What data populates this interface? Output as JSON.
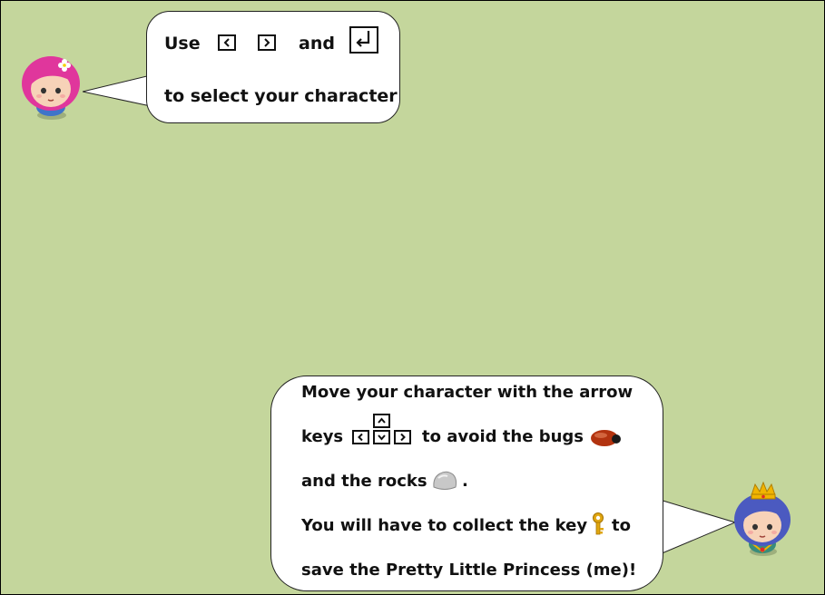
{
  "colors": {
    "background": "#c4d69c",
    "bubble_fill": "#ffffff",
    "bubble_border": "#222222",
    "girl_hair": "#e0369c",
    "princess_hair": "#4b5ac0",
    "crown": "#f1b400",
    "bug": "#b2330f",
    "rock": "#c8c8c8",
    "key_icon": "#e0a610"
  },
  "intro_bubble": {
    "use": "Use",
    "and": "and",
    "select": "to select your character",
    "icons": [
      "left-arrow-key",
      "right-arrow-key",
      "enter-key"
    ]
  },
  "instructions_bubble": {
    "line1": "Move your character with the arrow",
    "keys_word": "keys",
    "avoid_bugs": "to avoid the bugs",
    "rocks": "and the rocks",
    "period": ".",
    "collect": "You will have to collect the key",
    "to": "to",
    "save": "save the Pretty Little Princess (me)!",
    "icons": [
      "up-arrow-key",
      "left-arrow-key",
      "down-arrow-key",
      "right-arrow-key",
      "bug-icon",
      "rock-icon",
      "key-icon"
    ]
  },
  "characters": {
    "guide": "girl-avatar",
    "princess": "princess-avatar"
  }
}
